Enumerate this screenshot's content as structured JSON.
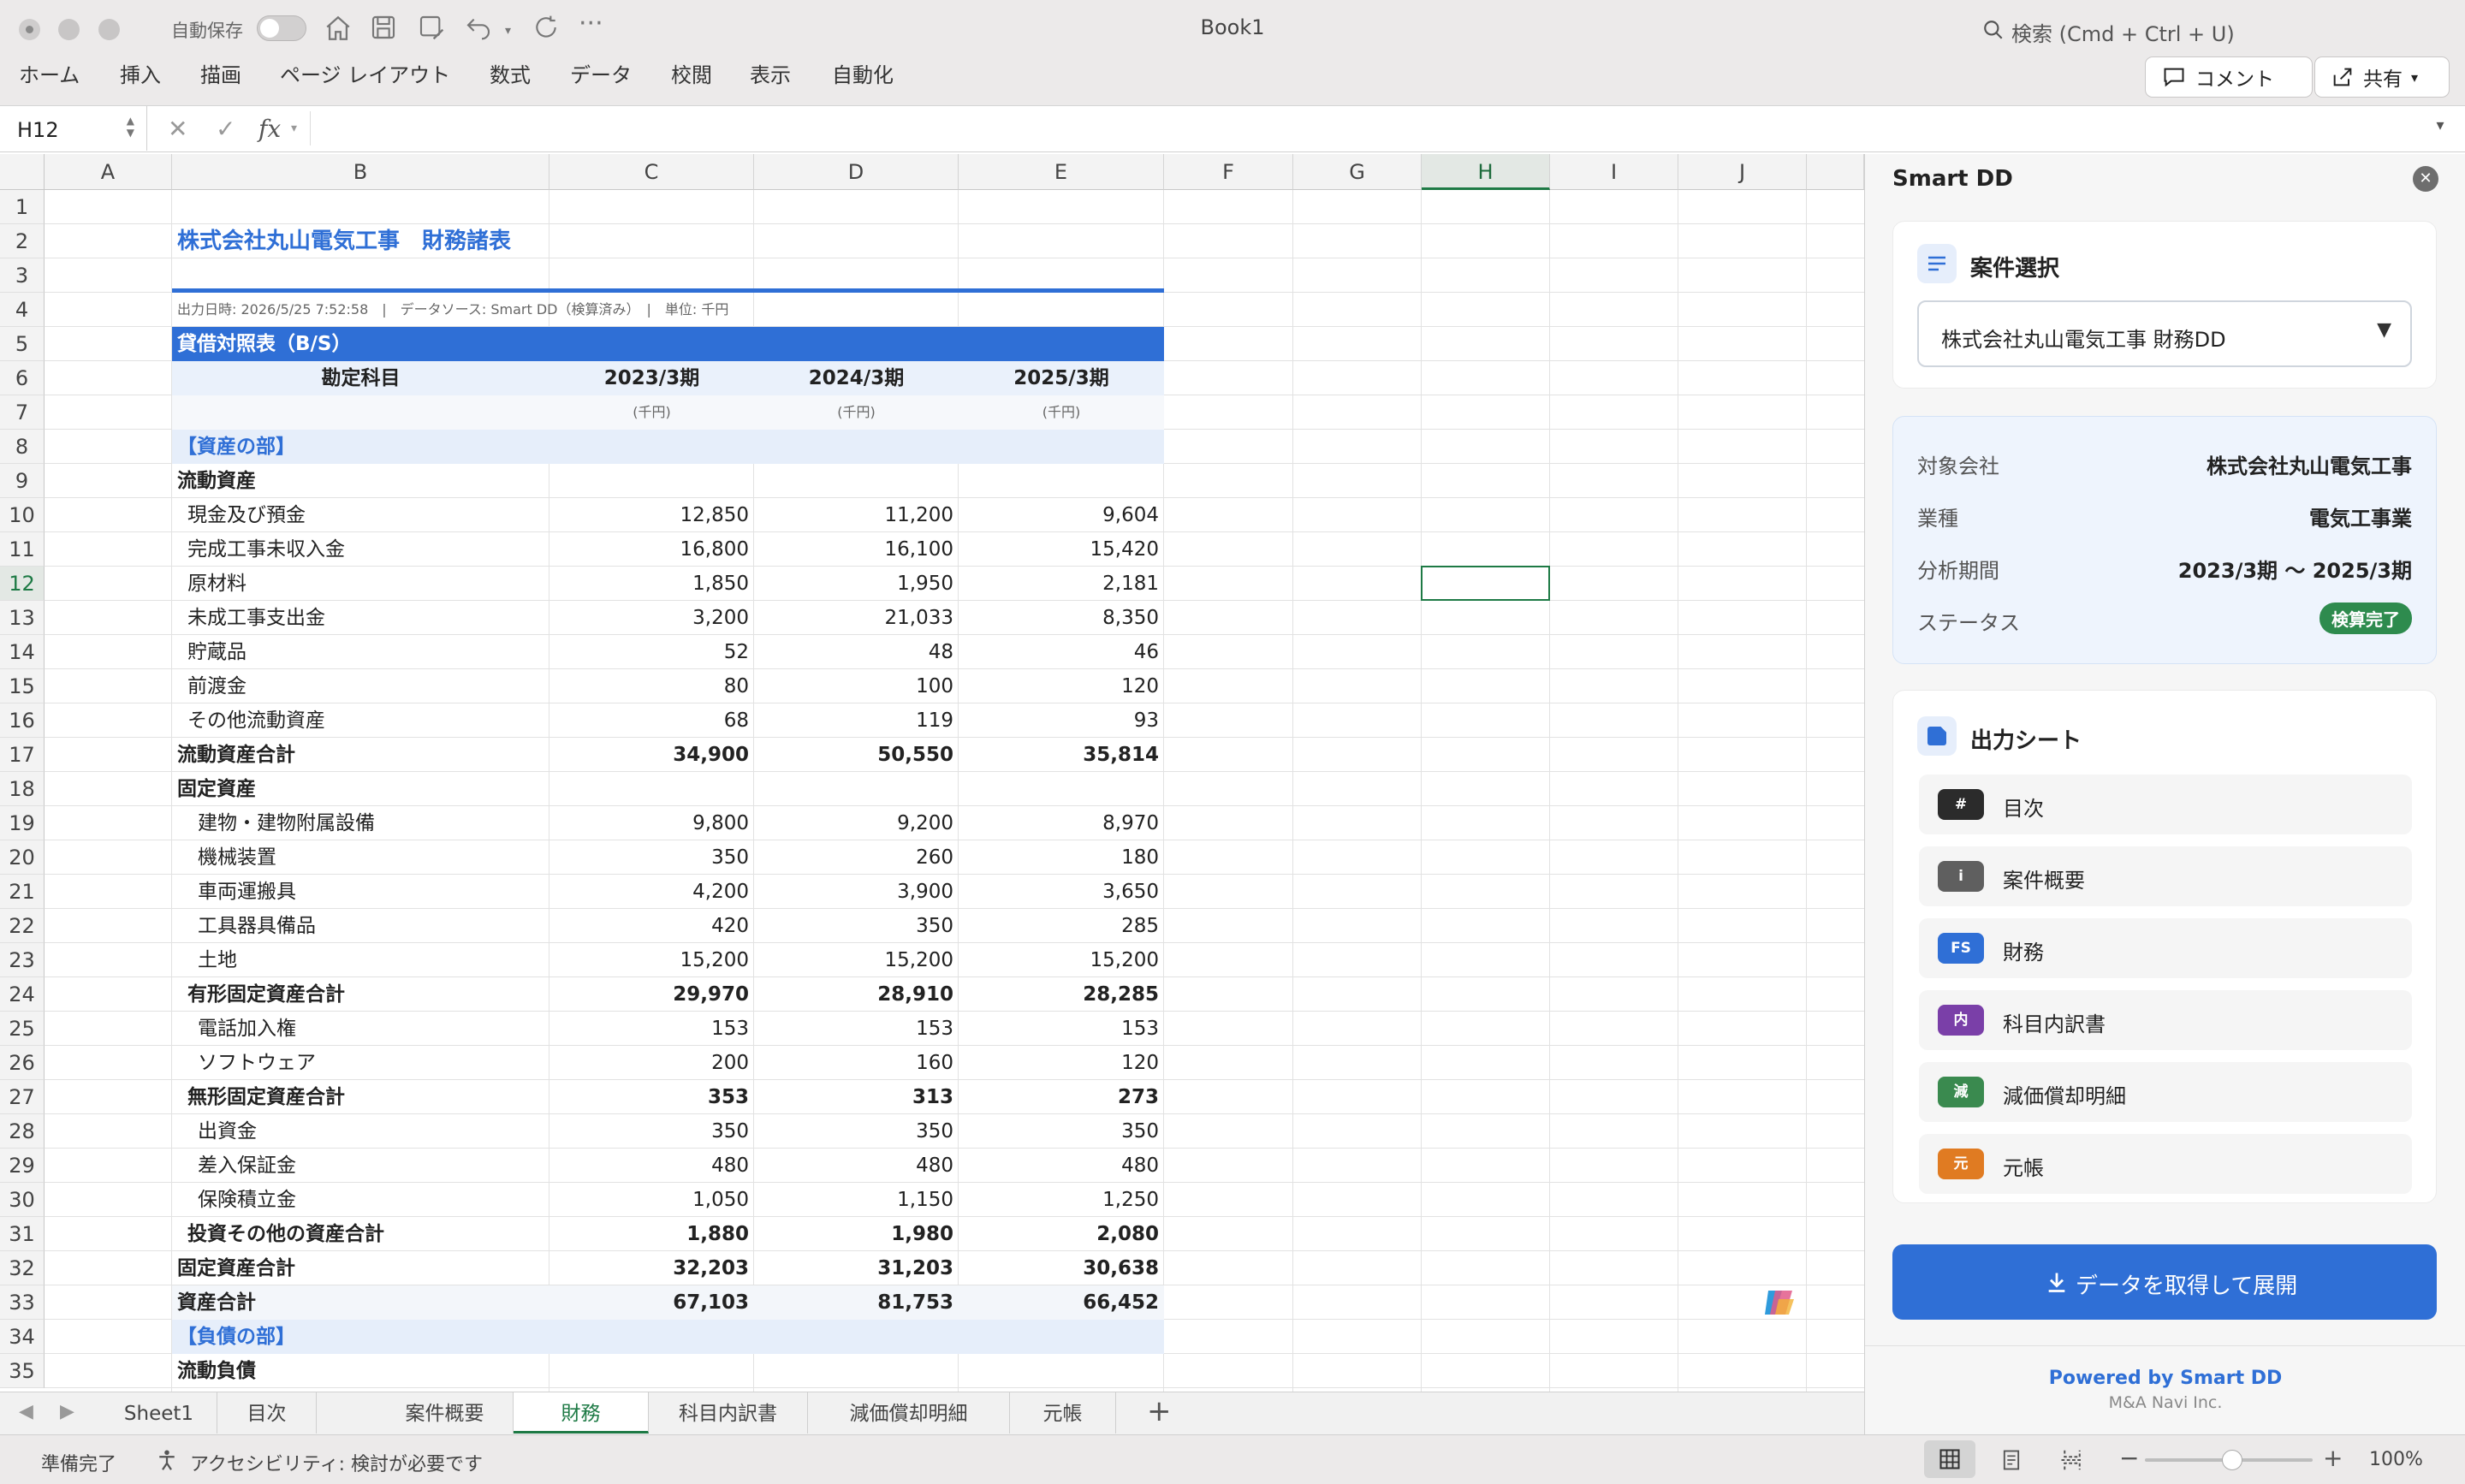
{
  "window": {
    "title": "Book1",
    "autosave_label": "自動保存",
    "search_label": "検索 (Cmd + Ctrl + U)"
  },
  "ribbon": {
    "tabs": [
      "ホーム",
      "挿入",
      "描画",
      "ページ レイアウト",
      "数式",
      "データ",
      "校閲",
      "表示",
      "自動化"
    ],
    "comment_label": "コメント",
    "share_label": "共有"
  },
  "formula_bar": {
    "name_box": "H12",
    "fx_label": "fx",
    "content": ""
  },
  "grid": {
    "columns": [
      "A",
      "B",
      "C",
      "D",
      "E",
      "F",
      "G",
      "H",
      "I",
      "J"
    ],
    "selected_column": "H",
    "selected_row": "12",
    "rows": [
      "1",
      "2",
      "3",
      "4",
      "5",
      "6",
      "7",
      "8",
      "9",
      "10",
      "11",
      "12",
      "13",
      "14",
      "15",
      "16",
      "17",
      "18",
      "19",
      "20",
      "21",
      "22",
      "23",
      "24",
      "25",
      "26",
      "27",
      "28",
      "29",
      "30",
      "31",
      "32",
      "33",
      "34",
      "35"
    ]
  },
  "report": {
    "title": "株式会社丸山電気工事　財務諸表",
    "meta": "出力日時: 2026/5/25 7:52:58　|　データソース: Smart DD（検算済み）　|　単位: 千円",
    "section": "貸借対照表（B/S）",
    "header": {
      "item": "勘定科目",
      "periods": [
        "2023/3期",
        "2024/3期",
        "2025/3期"
      ],
      "unit": "(千円)"
    },
    "lines": [
      {
        "label": "【資産の部】",
        "kind": "group"
      },
      {
        "label": "流動資産",
        "kind": "subhead"
      },
      {
        "label": "現金及び預金",
        "values": [
          "12,850",
          "11,200",
          "9,604"
        ],
        "kind": "item1"
      },
      {
        "label": "完成工事未収入金",
        "values": [
          "16,800",
          "16,100",
          "15,420"
        ],
        "kind": "item1"
      },
      {
        "label": "原材料",
        "values": [
          "1,850",
          "1,950",
          "2,181"
        ],
        "kind": "item1"
      },
      {
        "label": "未成工事支出金",
        "values": [
          "3,200",
          "21,033",
          "8,350"
        ],
        "kind": "item1"
      },
      {
        "label": "貯蔵品",
        "values": [
          "52",
          "48",
          "46"
        ],
        "kind": "item1"
      },
      {
        "label": "前渡金",
        "values": [
          "80",
          "100",
          "120"
        ],
        "kind": "item1"
      },
      {
        "label": "その他流動資産",
        "values": [
          "68",
          "119",
          "93"
        ],
        "kind": "item1"
      },
      {
        "label": "流動資産合計",
        "values": [
          "34,900",
          "50,550",
          "35,814"
        ],
        "kind": "total"
      },
      {
        "label": "固定資産",
        "kind": "subhead"
      },
      {
        "label": "建物・建物附属設備",
        "values": [
          "9,800",
          "9,200",
          "8,970"
        ],
        "kind": "item2"
      },
      {
        "label": "機械装置",
        "values": [
          "350",
          "260",
          "180"
        ],
        "kind": "item2"
      },
      {
        "label": "車両運搬具",
        "values": [
          "4,200",
          "3,900",
          "3,650"
        ],
        "kind": "item2"
      },
      {
        "label": "工具器具備品",
        "values": [
          "420",
          "350",
          "285"
        ],
        "kind": "item2"
      },
      {
        "label": "土地",
        "values": [
          "15,200",
          "15,200",
          "15,200"
        ],
        "kind": "item2"
      },
      {
        "label": "有形固定資産合計",
        "values": [
          "29,970",
          "28,910",
          "28,285"
        ],
        "kind": "subtotal"
      },
      {
        "label": "電話加入権",
        "values": [
          "153",
          "153",
          "153"
        ],
        "kind": "item2"
      },
      {
        "label": "ソフトウェア",
        "values": [
          "200",
          "160",
          "120"
        ],
        "kind": "item2"
      },
      {
        "label": "無形固定資産合計",
        "values": [
          "353",
          "313",
          "273"
        ],
        "kind": "subtotal"
      },
      {
        "label": "出資金",
        "values": [
          "350",
          "350",
          "350"
        ],
        "kind": "item2"
      },
      {
        "label": "差入保証金",
        "values": [
          "480",
          "480",
          "480"
        ],
        "kind": "item2"
      },
      {
        "label": "保険積立金",
        "values": [
          "1,050",
          "1,150",
          "1,250"
        ],
        "kind": "item2"
      },
      {
        "label": "投資その他の資産合計",
        "values": [
          "1,880",
          "1,980",
          "2,080"
        ],
        "kind": "subtotal"
      },
      {
        "label": "固定資産合計",
        "values": [
          "32,203",
          "31,203",
          "30,638"
        ],
        "kind": "total"
      },
      {
        "label": "資産合計",
        "values": [
          "67,103",
          "81,753",
          "66,452"
        ],
        "kind": "grand"
      },
      {
        "label": "【負債の部】",
        "kind": "group"
      },
      {
        "label": "流動負債",
        "kind": "subhead"
      }
    ]
  },
  "sheet_tabs": [
    "Sheet1",
    "目次",
    "案件概要",
    "財務",
    "科目内訳書",
    "減価償却明細",
    "元帳"
  ],
  "active_sheet": "財務",
  "status": {
    "ready": "準備完了",
    "accessibility": "アクセシビリティ: 検討が必要です",
    "zoom": "100%"
  },
  "pane": {
    "title": "Smart DD",
    "case_select_title": "案件選択",
    "case_selected": "株式会社丸山電気工事 財務DD",
    "info": [
      {
        "label": "対象会社",
        "value": "株式会社丸山電気工事"
      },
      {
        "label": "業種",
        "value": "電気工事業"
      },
      {
        "label": "分析期間",
        "value": "2023/3期 〜 2025/3期"
      },
      {
        "label": "ステータス",
        "value": "検算完了"
      }
    ],
    "status_color": "#2e8b4e",
    "output_title": "出力シート",
    "sheets": [
      {
        "badge": "#",
        "label": "目次",
        "color": "#2b2b2b"
      },
      {
        "badge": "i",
        "label": "案件概要",
        "color": "#5f5f5f"
      },
      {
        "badge": "FS",
        "label": "財務",
        "color": "#2f6fd6"
      },
      {
        "badge": "内",
        "label": "科目内訳書",
        "color": "#7a3fa8"
      },
      {
        "badge": "減",
        "label": "減価償却明細",
        "color": "#3a8a4f"
      },
      {
        "badge": "元",
        "label": "元帳",
        "color": "#e07b22"
      }
    ],
    "action_label": "データを取得して展開",
    "footer_brand": "Powered by Smart DD",
    "footer_company": "M&A Navi Inc."
  },
  "colors": {
    "accent": "#2f6fd6",
    "excel_green": "#1e7a45",
    "section_bg": "#2f6fd6",
    "header_bg": "#eaf1fb"
  }
}
